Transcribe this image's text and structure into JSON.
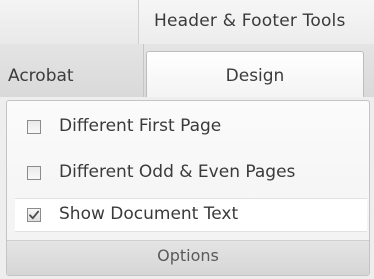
{
  "contextual_tab": {
    "title": "Header & Footer Tools"
  },
  "tabs": [
    {
      "label": "Acrobat",
      "active": false
    },
    {
      "label": "Design",
      "active": true
    }
  ],
  "group": {
    "label": "Options",
    "options": [
      {
        "label": "Different First Page",
        "checked": false
      },
      {
        "label": "Different Odd & Even Pages",
        "checked": false
      },
      {
        "label": "Show Document Text",
        "checked": true
      }
    ]
  }
}
